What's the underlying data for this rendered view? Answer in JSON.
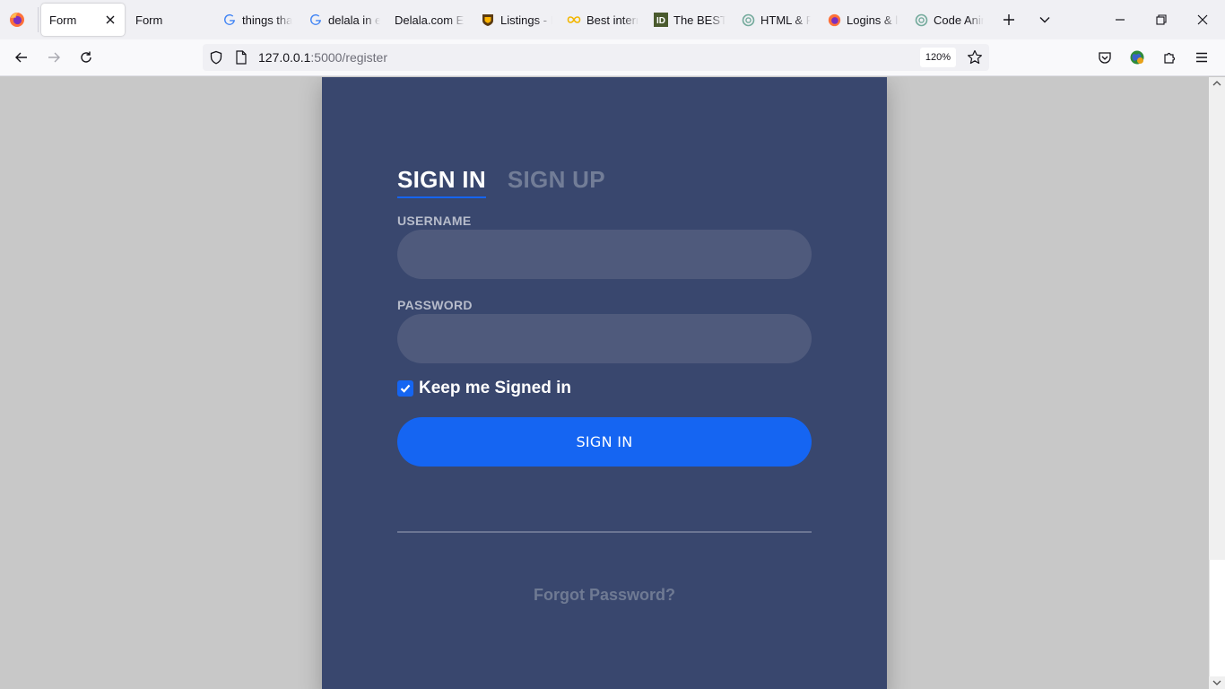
{
  "browser": {
    "tabs": [
      {
        "label": "Form",
        "icon": "none",
        "active": true
      },
      {
        "label": "Form",
        "icon": "none"
      },
      {
        "label": "things tha",
        "icon": "google-icon"
      },
      {
        "label": "delala in e",
        "icon": "google-icon"
      },
      {
        "label": "Delala.com Et",
        "icon": "none"
      },
      {
        "label": "Listings - I",
        "icon": "ups-icon"
      },
      {
        "label": "Best intern",
        "icon": "infinity-icon"
      },
      {
        "label": "The BEST 3",
        "icon": "id-icon"
      },
      {
        "label": "HTML & F",
        "icon": "openai-icon"
      },
      {
        "label": "Logins & l",
        "icon": "firefox-icon"
      },
      {
        "label": "Code Anin",
        "icon": "openai-icon"
      }
    ],
    "url_host": "127.0.0.1",
    "url_rest": ":5000/register",
    "zoom": "120%"
  },
  "form": {
    "tab_signin": "SIGN IN",
    "tab_signup": "SIGN UP",
    "username_label": "USERNAME",
    "username_value": "",
    "password_label": "PASSWORD",
    "password_value": "",
    "keep_signed_in_label": "Keep me Signed in",
    "keep_signed_in_checked": true,
    "submit_label": "SIGN IN",
    "forgot_label": "Forgot Password?"
  },
  "colors": {
    "card_bg": "#39476e",
    "accent": "#1565f2",
    "input_bg": "#4f5a7c",
    "page_bg": "#c8c8c8"
  }
}
